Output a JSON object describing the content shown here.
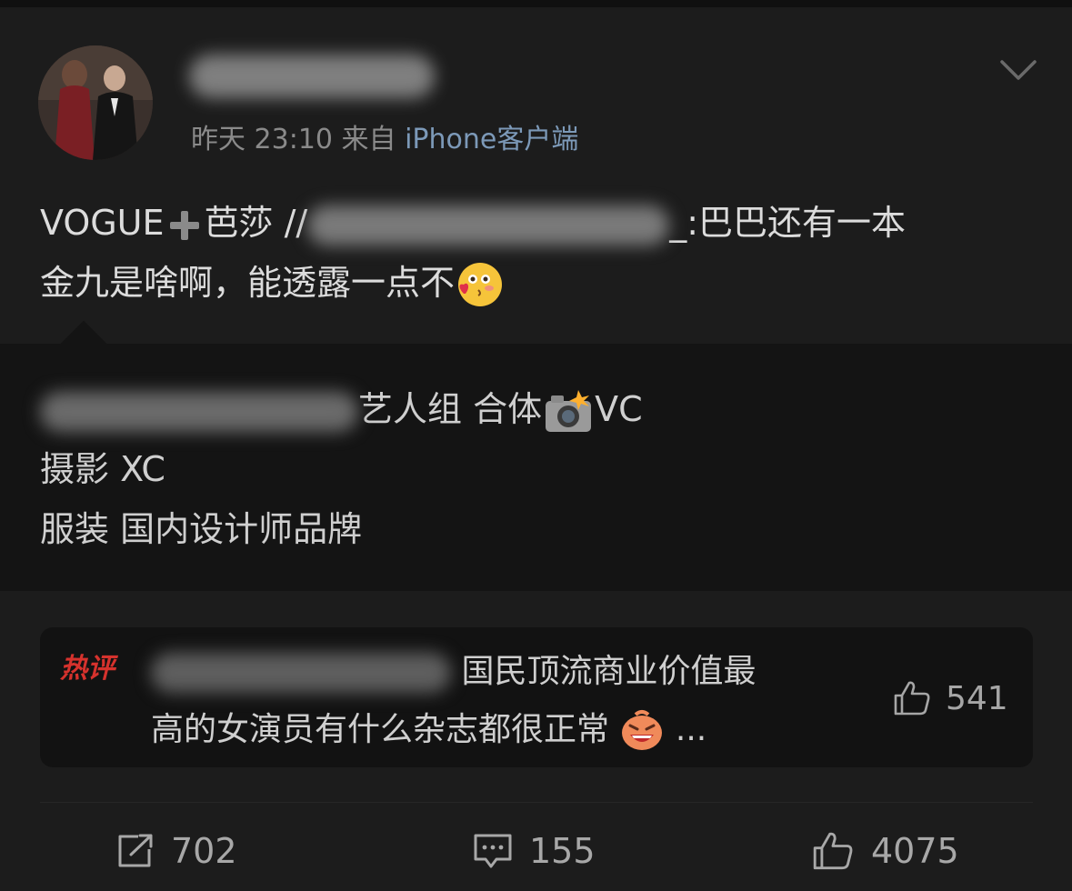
{
  "post": {
    "time": "昨天 23:10",
    "source_prefix": "来自",
    "source_client": "iPhone客户端",
    "text_part1": "VOGUE",
    "text_part2": "芭莎 //",
    "text_part3": "_:巴巴还有一本",
    "text_line2": "金九是啥啊，能透露一点不"
  },
  "quoted": {
    "line1_suffix": "艺人组 合体",
    "line1_tail": "VC",
    "line2": "摄影 XC",
    "line3": "服装 国内设计师品牌"
  },
  "hot_comment": {
    "tag": "热评",
    "text_line1": "国民顶流商业价值最",
    "text_line2": "高的女演员有什么杂志都很正常",
    "ellipsis": "...",
    "likes": "541"
  },
  "actions": {
    "reposts": "702",
    "comments": "155",
    "likes": "4075"
  },
  "icons": {
    "menu": "chevron-down-icon",
    "plus": "heavy-plus-icon",
    "emoji": "kiss-blush-emoji-icon",
    "camera": "camera-flash-icon",
    "laugh": "laughing-face-icon",
    "repost": "repost-icon",
    "comment": "comment-icon",
    "like": "thumbs-up-icon"
  },
  "colors": {
    "background": "#1c1c1c",
    "quoted_background": "#141414",
    "client_link": "#7c99b8",
    "hot_tag": "#d6322d"
  }
}
